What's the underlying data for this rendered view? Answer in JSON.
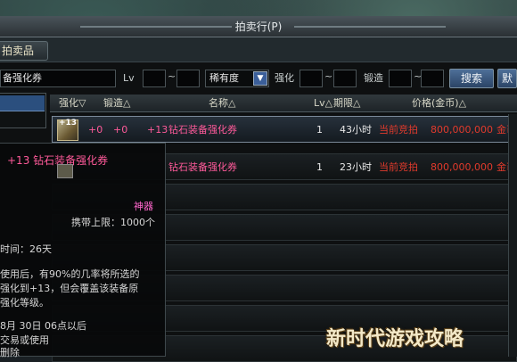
{
  "window": {
    "title": "拍卖行(P)"
  },
  "tabs": [
    {
      "label": "拍卖品"
    }
  ],
  "filters": {
    "item_name_value": "备强化券",
    "lv_label": "Lv",
    "tilde": "~",
    "rarity_value": "稀有度",
    "enhance_label": "强化",
    "forge_label": "锻造",
    "search_label": "搜索",
    "reset_label": "默"
  },
  "table": {
    "headers": [
      "强化▽",
      "锻造△",
      "名称△",
      "Lv△",
      "期限△",
      "价格(金币)△"
    ],
    "rows": [
      {
        "enhance": "+0",
        "forge": "+0",
        "plus": "+13",
        "name": "钻石装备强化券",
        "lv": "1",
        "duration": "43小时",
        "status": "当前竞拍",
        "price": "800,000,000",
        "currency": "金币"
      },
      {
        "name": "钻石装备强化券",
        "lv": "1",
        "duration": "23小时",
        "status": "当前竞拍",
        "price": "800,000,000",
        "currency": "金币"
      }
    ]
  },
  "tooltip": {
    "title": "+13 钻石装备强化券",
    "grade": "神器",
    "carry_limit": "携带上限：1000个",
    "time_fragment": "时间：26天",
    "desc_1": "使用后，有90%的几率将所选的",
    "desc_2": "强化到+13，但会覆盖该装备原",
    "desc_3": "强化等级。",
    "date_fragment": "8月 30日  06点以后",
    "trade_fragment": "交易或使用",
    "delete_fragment": "删除"
  },
  "watermark": "新时代游戏攻略",
  "icons": {
    "rarity_dropdown": "chevron-down-icon",
    "item": "enhance-ticket-icon"
  },
  "colors": {
    "pink_name": "#ff5a9a",
    "red_price": "#e23a2c",
    "button_blue": "#2b4466"
  }
}
